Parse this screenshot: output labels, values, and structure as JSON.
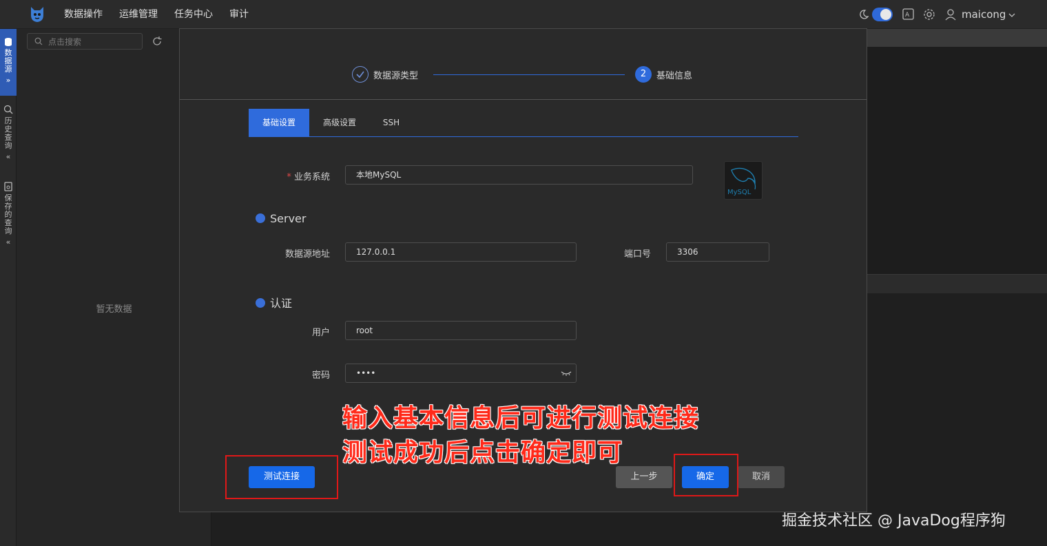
{
  "topnav": {
    "items": [
      "数据操作",
      "运维管理",
      "任务中心",
      "审计"
    ],
    "username": "maicong"
  },
  "vsidebar": {
    "tabs": [
      {
        "label": "数据源"
      },
      {
        "label": "历史查询"
      },
      {
        "label": "保存的查询"
      }
    ]
  },
  "leftpanel": {
    "search_placeholder": "点击搜索",
    "empty_text": "暂无数据"
  },
  "modal": {
    "steps": [
      {
        "label": "数据源类型",
        "status": "done"
      },
      {
        "number": "2",
        "label": "基础信息",
        "status": "current"
      }
    ],
    "tabs": [
      "基础设置",
      "高级设置",
      "SSH"
    ],
    "active_tab": "基础设置",
    "form": {
      "business_label": "业务系统",
      "business_required": "*",
      "business_value": "本地MySQL",
      "server_section": "Server",
      "host_label": "数据源地址",
      "host_value": "127.0.0.1",
      "port_label": "端口号",
      "port_value": "3306",
      "auth_section": "认证",
      "user_label": "用户",
      "user_value": "root",
      "password_label": "密码",
      "password_value": "••••"
    },
    "logo_text": "MySQL",
    "buttons": {
      "test": "测试连接",
      "prev": "上一步",
      "confirm": "确定",
      "cancel": "取消"
    }
  },
  "annotation": {
    "line1": "输入基本信息后可进行测试连接",
    "line2": "测试成功后点击确定即可"
  },
  "watermark": "掘金技术社区 @ JavaDog程序狗",
  "colors": {
    "accent": "#2f6bdc",
    "primary_button": "#1668e8",
    "annotation_red": "#ff2a1a"
  }
}
